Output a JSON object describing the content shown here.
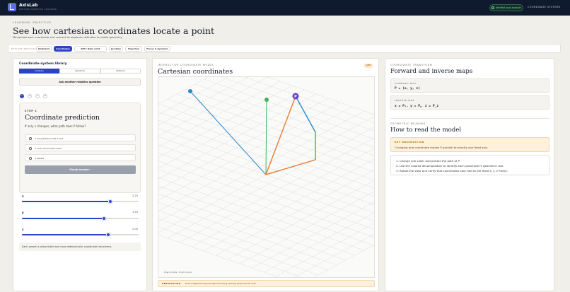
{
  "app": {
    "name": "AxisLab",
    "subtitle": "Verified robotics learning"
  },
  "topbar": {
    "verified_label": "Verified local module",
    "systems_link": "COORDINATE SYSTEMS"
  },
  "header": {
    "eyebrow": "LEARNING OBJECTIVE",
    "title": "See how cartesian coordinates locate a point",
    "subtitle": "Manipulate each coordinate and connect its algebraic definition to visible geometry."
  },
  "modules": {
    "label": "EXPLORE MODULES",
    "items": [
      {
        "label": "Gimbaloni"
      },
      {
        "label": "Coordinates"
      },
      {
        "label": "RPY / Robo wrist"
      },
      {
        "label": "Jacobian"
      },
      {
        "label": "Trajectory"
      },
      {
        "label": "Forces & dynamics"
      }
    ],
    "active_index": 1
  },
  "library": {
    "title": "Coordinate-system library",
    "systems": [
      "Cartesian",
      "Cylindrical",
      "Spherical"
    ],
    "active_system": 0,
    "ask_button": "Ask another robotics question",
    "steps": [
      "1",
      "2",
      "3",
      "4"
    ],
    "active_step": 0
  },
  "question": {
    "step_label": "STEP 1",
    "title": "Coordinate prediction",
    "text": "If only x changes, what path does P follow?",
    "options": [
      "A line parallel to the x-axis",
      "A circle around the z-axis",
      "A sphere"
    ],
    "check_button": "Check answer ›"
  },
  "sliders": [
    {
      "name": "x",
      "value_text": "2.20",
      "fraction": 0.76
    },
    {
      "name": "y",
      "value_text": "1.50",
      "fraction": 0.7
    },
    {
      "name": "z",
      "value_text": "2.00",
      "fraction": 0.74
    }
  ],
  "library_note": "Each preset is allow-listed and uses deterministic coordinate transforms.",
  "model": {
    "eyebrow": "INTERACTIVE COORDINATE MODEL",
    "title": "Cartesian coordinates",
    "badge": "LIVE",
    "point_label": "P",
    "hint": "Drag to rotate · Scroll to zoom",
    "observation_label": "OBSERVATION",
    "observation_text": "Three independent signed distances along mutually perpendicular axes.",
    "colors": {
      "x": "#e87b2c",
      "y": "#2a8bc9",
      "z": "#3fb35a",
      "point": "#6a3ec6"
    }
  },
  "transform": {
    "eyebrow": "COORDINATE TRANSFORM",
    "title": "Forward and inverse maps",
    "forward_label": "FORWARD MAP",
    "forward_formula": "P = (x, y, z)",
    "inverse_label": "INVERSE MAP",
    "inverse_formula": "x = Pₓ, y = Pᵧ, z = P_z"
  },
  "meaning": {
    "eyebrow": "GEOMETRIC MEANING",
    "title": "How to read the model",
    "key_label": "KEY OBSERVATION",
    "key_text": "Changing one coordinate moves P parallel to exactly one fixed axis.",
    "steps": [
      "1. Change one slider and predict the path of P.",
      "2. Use the colored decomposition to identify each parameter's geometric role.",
      "3. Rotate the view and verify that coordinates stay tied to the fixed x, y, z frame."
    ]
  }
}
